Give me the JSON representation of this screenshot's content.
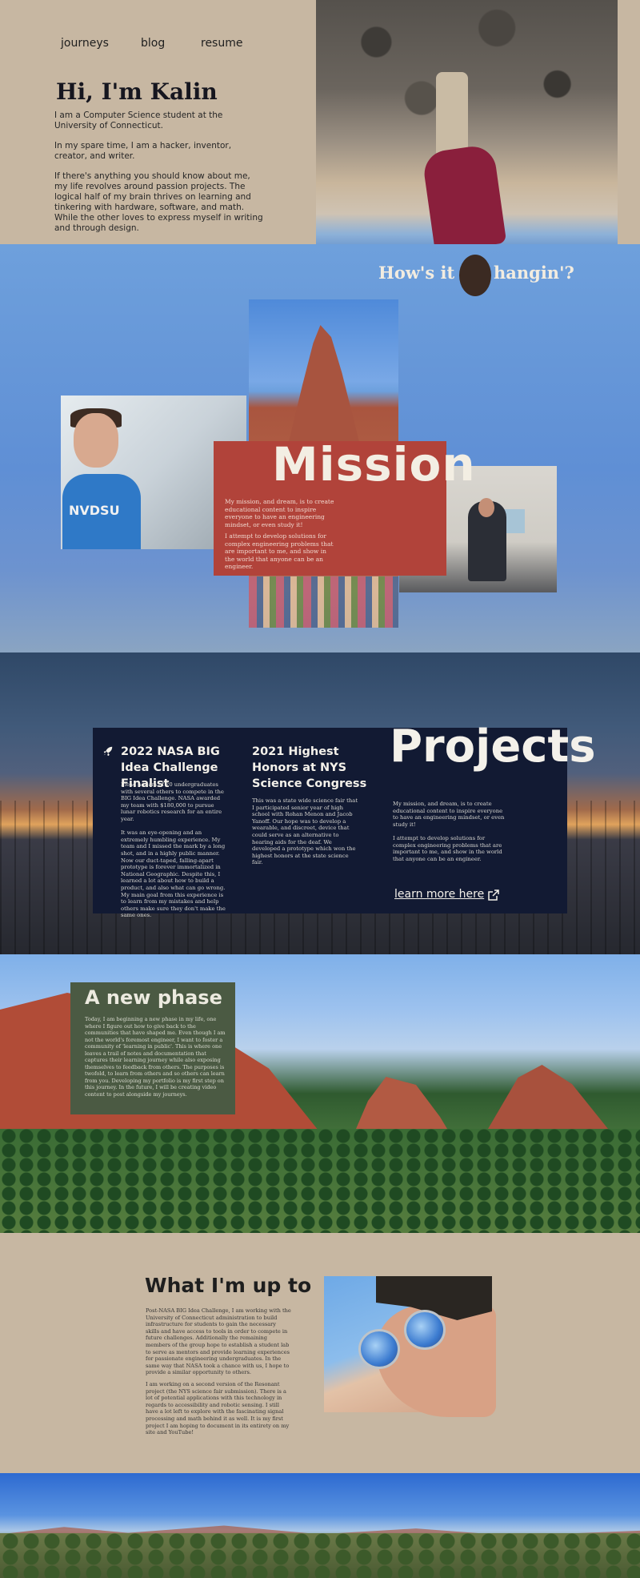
{
  "nav": {
    "journeys": "journeys",
    "blog": "blog",
    "resume": "resume"
  },
  "hero": {
    "title": "Hi, I'm Kalin",
    "p1": "I am a Computer Science student at the University of Connecticut.",
    "p2": "In my spare time, I am a hacker, inventor, creator, and writer.",
    "p3": "If there's anything you should know about me, my life revolves around passion projects. The logical half of my brain thrives on learning and tinkering with hardware, software, and math. While the other loves to express myself in writing and through design."
  },
  "greeting": {
    "left": "How's it",
    "right": "hangin'?"
  },
  "lab_shirt_text": "NVDSU",
  "mission": {
    "title": "Mission",
    "p1": "My mission, and dream, is to create educational content to inspire everyone to have an engineering mindset, or even study it!",
    "p2": "I attempt to develop solutions for complex engineering problems that are important to me, and show in the world that anyone can be an engineer."
  },
  "projects": {
    "title": "Projects",
    "item1_title": "2022 NASA BIG Idea Challenge Finalist",
    "item1_text": "I lead a team of 20 undergraduates with several others to compete in the BIG Idea Challenge. NASA awarded my team with $180,000 to pursue lunar robotics research for an entire year.\n\nIt was an eye-opening and an extremely humbling experience. My team and I missed the mark by a long shot, and in a highly public manner. Now our duct-taped, falling-apart prototype is forever immortalized in National Geographic. Despite this, I learned a lot about how to build a product, and also what can go wrong. My main goal from this experience is to learn from my mistakes and help others make sure they don't make the same ones.",
    "item2_title": "2021 Highest Honors at NYS Science Congress",
    "item2_text": "This was a state wide science fair that I participated senior year of high school with Rohan Menon and Jacob Yanoff. Our hope was to develop a wearable, and discreet, device that could serve as an alternative to hearing aids for the deaf. We developed a prototype which won the highest honors at the state science fair.",
    "side_p1": "My mission, and dream, is to create educational content to inspire everyone to have an engineering mindset, or even study it!",
    "side_p2": "I attempt to develop solutions for complex engineering problems that are important to me, and show in the world that anyone can be an engineer.",
    "link": "learn more here"
  },
  "phase": {
    "title": "A new phase",
    "text": "Today, I am beginning a new phase in my life, one where I figure out how to give back to the communities that have shaped me. Even though I am not the world's foremost engineer, I want to foster a community of 'learning in public'. This is where one leaves a trail of notes and documentation that captures their learning journey while also exposing themselves to feedback from others. The purposes is twofold, to learn from others and so others can learn from you. Developing my portfolio is my first step on this journey. In the future, I will be creating video content to post alongside my journeys."
  },
  "upto": {
    "title": "What I'm up to",
    "p1": "Post-NASA BIG Idea Challenge, I am working with the University of Connecticut administration to build infrastructure for students to gain the necessary skills and have access to tools in order to compete in future challenges. Additionally the remaining members of the group hope to establish a student lab to serve as mentors and provide learning experiences for passionate engineering undergraduates. In the same way that NASA took a chance with us, I hope to provide a similar opportunity to others.",
    "p2": "I am working on a second version of the Resonant project (the NYS science fair submission). There is a lot of potential applications with this technology in regards to accessibility and robotic sensing. I still have a lot left to explore with the fascinating signal processing and math behind it as well. It is my first project I am hoping to document in its entirety on my site and YouTube!"
  },
  "icons": {
    "rocket": "rocket-icon",
    "external": "external-link-icon"
  }
}
